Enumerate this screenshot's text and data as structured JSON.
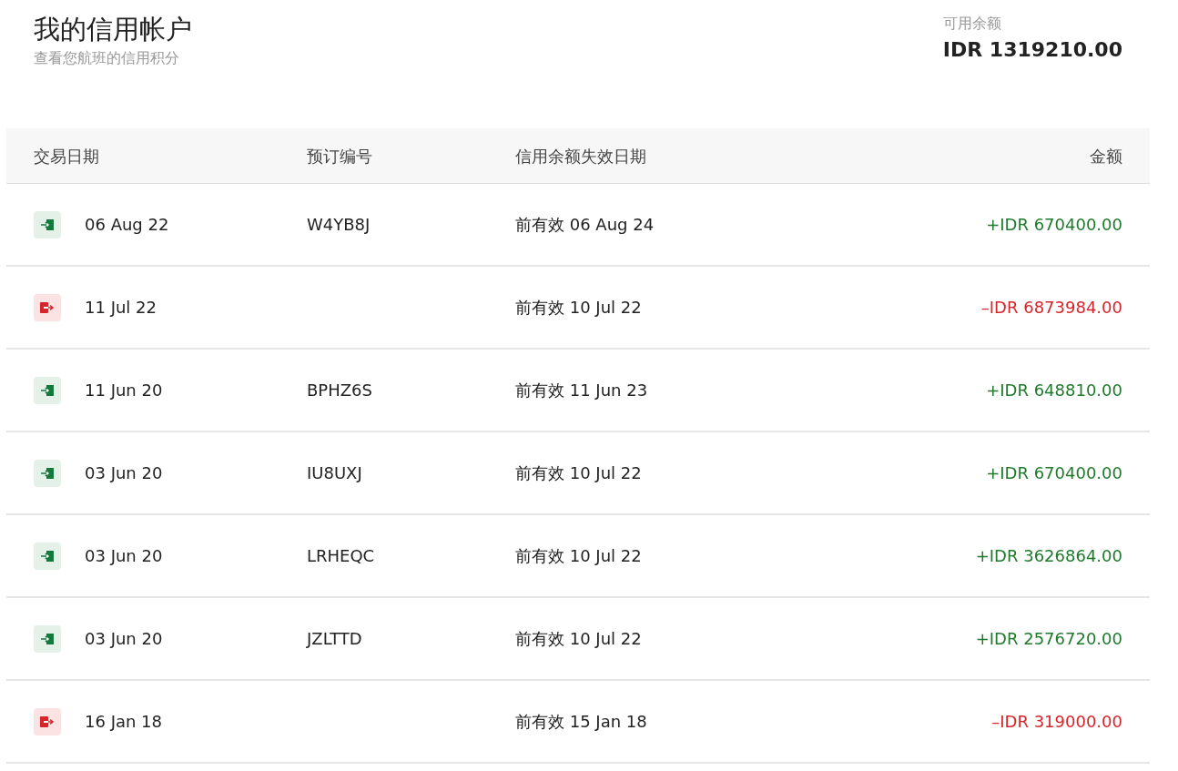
{
  "header": {
    "title": "我的信用帐户",
    "subtitle": "查看您航班的信用积分"
  },
  "balance": {
    "label": "可用余额",
    "value": "IDR 1319210.00"
  },
  "table": {
    "columns": [
      "交易日期",
      "预订编号",
      "信用余额失效日期",
      "金额"
    ],
    "rows": [
      {
        "kind": "credit",
        "date": "06 Aug 22",
        "booking": "W4YB8J",
        "expiry": "前有效 06 Aug 24",
        "amount": "+IDR 670400.00"
      },
      {
        "kind": "debit",
        "date": "11 Jul 22",
        "booking": "",
        "expiry": "前有效 10 Jul 22",
        "amount": "–IDR 6873984.00"
      },
      {
        "kind": "credit",
        "date": "11 Jun 20",
        "booking": "BPHZ6S",
        "expiry": "前有效 11 Jun 23",
        "amount": "+IDR 648810.00"
      },
      {
        "kind": "credit",
        "date": "03 Jun 20",
        "booking": "IU8UXJ",
        "expiry": "前有效 10 Jul 22",
        "amount": "+IDR 670400.00"
      },
      {
        "kind": "credit",
        "date": "03 Jun 20",
        "booking": "LRHEQC",
        "expiry": "前有效 10 Jul 22",
        "amount": "+IDR 3626864.00"
      },
      {
        "kind": "credit",
        "date": "03 Jun 20",
        "booking": "JZLTTD",
        "expiry": "前有效 10 Jul 22",
        "amount": "+IDR 2576720.00"
      },
      {
        "kind": "debit",
        "date": "16 Jan 18",
        "booking": "",
        "expiry": "前有效 15 Jan 18",
        "amount": "–IDR 319000.00"
      }
    ]
  }
}
